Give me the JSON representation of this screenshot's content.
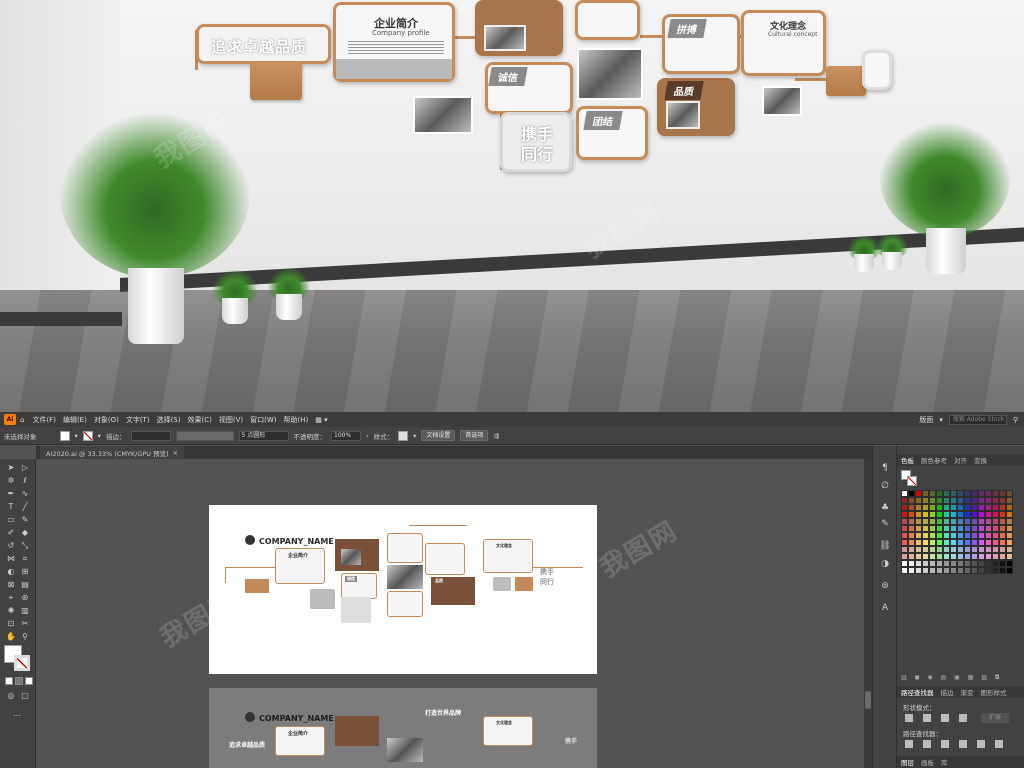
{
  "scene": {
    "wall_title": "追求卓越品质",
    "company_intro_title": "企业简介",
    "company_intro_sub": "Company profile",
    "tag_chengxin": "诚信",
    "tag_tuanjie": "团结",
    "tag_tuozhan": "拼搏",
    "tag_pinzhi": "品质",
    "culture_title": "文化理念",
    "culture_sub": "Cultural concept",
    "xieshou_1": "携手",
    "xieshou_2": "同行"
  },
  "menubar": {
    "app_logo": "Ai",
    "items": [
      "文件(F)",
      "编辑(E)",
      "对象(O)",
      "文字(T)",
      "选择(S)",
      "效果(C)",
      "视图(V)",
      "窗口(W)",
      "帮助(H)"
    ],
    "workspace": "版面",
    "search_placeholder": "搜索 Adobe Stock"
  },
  "controlbar": {
    "selection_status": "未选择对象",
    "stroke_label": "描边：",
    "brush_value": "5 点圆形",
    "opacity_label": "不透明度：",
    "opacity_value": "100%",
    "style_label": "样式：",
    "doc_setup_button": "文档设置",
    "preferences_button": "首选项"
  },
  "document": {
    "tab_label": "AI2020.ai @ 33.33% (CMYK/GPU 预览)",
    "close_glyph": "×"
  },
  "artboard": {
    "company_name": "COMPANY_NAME",
    "intro_title": "企业简介",
    "culture_title": "文化理念",
    "tag_chengxin": "诚信",
    "tag_pinzhi": "品质",
    "xieshou": "携手",
    "tongxing": "同行",
    "brand_title": "打造世界品牌",
    "wall_title": "追求卓越品质"
  },
  "panels": {
    "swatch_tabs": [
      "色板",
      "颜色参考",
      "对齐",
      "变换"
    ],
    "pathfinder_tabs": [
      "路径查找器",
      "描边",
      "渐变",
      "图形样式"
    ],
    "shape_modes_label": "形状模式：",
    "pathfinder_label": "路径查找器：",
    "expand_button": "扩展",
    "layers_tabs": [
      "图层",
      "画板",
      "库"
    ]
  },
  "watermark_text": "我图网",
  "colors": {
    "accent": "#c58c5a",
    "app_bg": "#535353",
    "panel_bg": "#424242",
    "menubar_bg": "#3c3c3c",
    "ai_logo": "#ff7c00"
  }
}
